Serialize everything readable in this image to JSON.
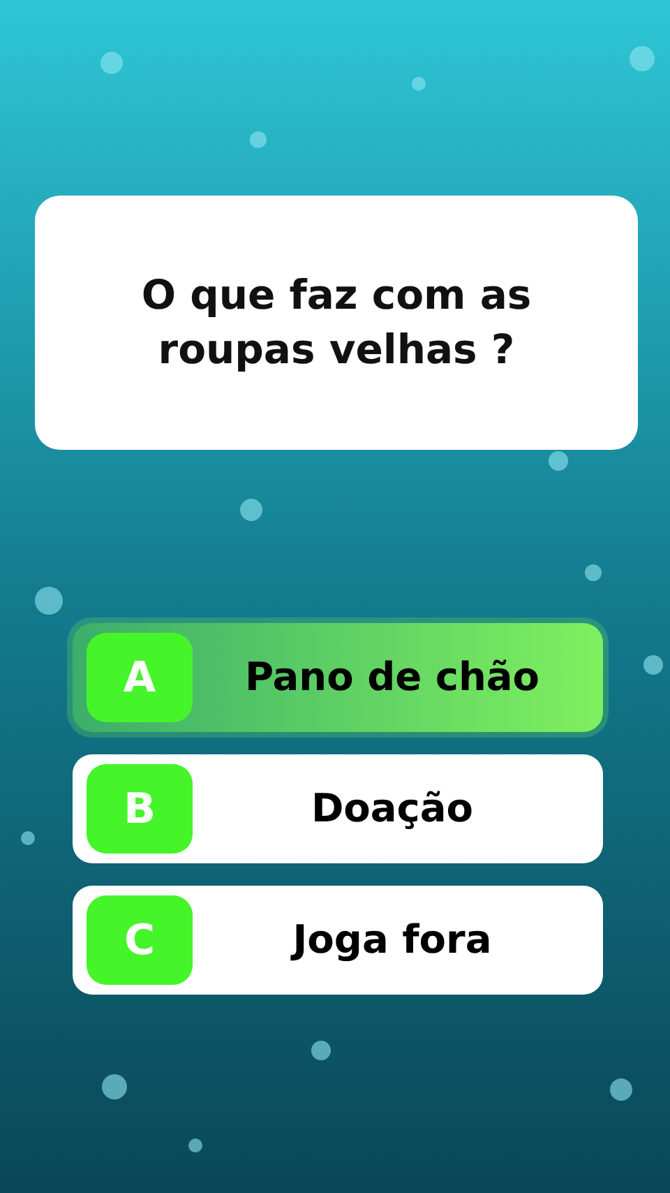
{
  "question": "O que faz com as roupas velhas ?",
  "options": [
    {
      "letter": "A",
      "text": "Pano de chão",
      "selected": true
    },
    {
      "letter": "B",
      "text": "Doação",
      "selected": false
    },
    {
      "letter": "C",
      "text": "Joga fora",
      "selected": false
    }
  ]
}
